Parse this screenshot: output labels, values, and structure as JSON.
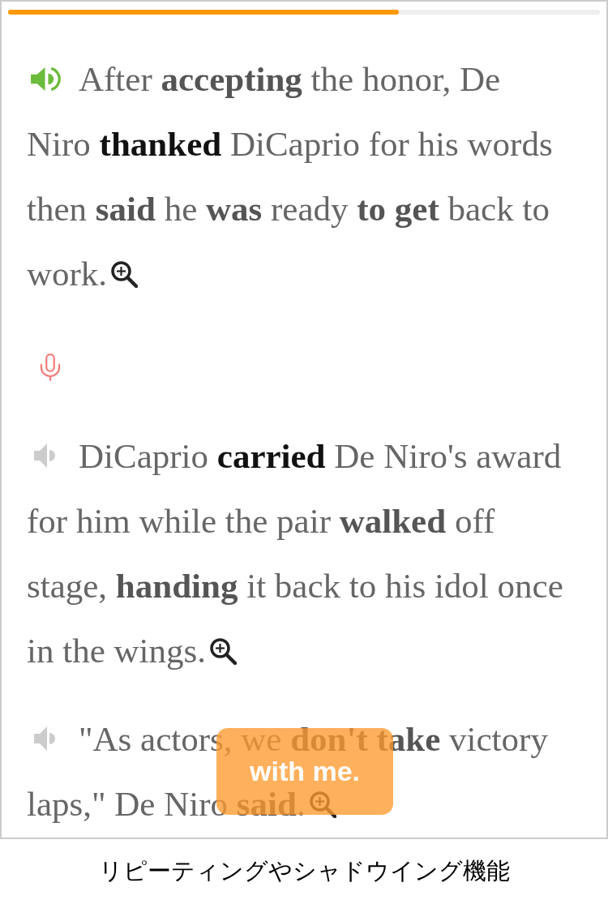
{
  "progress": {
    "level": 0.66
  },
  "items": [
    {
      "kind": "sentence",
      "playing": true,
      "lines": [
        [
          {
            "text": "After ",
            "kind": "plain",
            "selected": false
          },
          {
            "text": "accepting",
            "kind": "keyword",
            "selected": false
          },
          {
            "text": " the honor, De",
            "kind": "plain",
            "selected": false
          }
        ],
        [
          {
            "text": "Niro ",
            "kind": "plain",
            "selected": false
          },
          {
            "text": "thanked",
            "kind": "keyword",
            "selected": true
          },
          {
            "text": " DiCaprio for his words",
            "kind": "plain",
            "selected": false
          }
        ],
        [
          {
            "text": "then ",
            "kind": "plain",
            "selected": false
          },
          {
            "text": "said",
            "kind": "keyword",
            "selected": false
          },
          {
            "text": " he ",
            "kind": "plain",
            "selected": false
          },
          {
            "text": "was",
            "kind": "keyword",
            "selected": false
          },
          {
            "text": " ready ",
            "kind": "plain",
            "selected": false
          },
          {
            "text": "to get",
            "kind": "keyword",
            "selected": false
          },
          {
            "text": " back to",
            "kind": "plain",
            "selected": false
          }
        ],
        [
          {
            "text": "work.",
            "kind": "plain",
            "selected": false
          }
        ]
      ]
    },
    {
      "kind": "record"
    },
    {
      "kind": "sentence",
      "playing": false,
      "lines": [
        [
          {
            "text": "DiCaprio ",
            "kind": "plain",
            "selected": false
          },
          {
            "text": "carried",
            "kind": "keyword",
            "selected": true
          },
          {
            "text": " De Niro's award",
            "kind": "plain",
            "selected": false
          }
        ],
        [
          {
            "text": "for him while the pair ",
            "kind": "plain",
            "selected": false
          },
          {
            "text": "walked",
            "kind": "keyword",
            "selected": false
          },
          {
            "text": " off",
            "kind": "plain",
            "selected": false
          }
        ],
        [
          {
            "text": "stage, ",
            "kind": "plain",
            "selected": false
          },
          {
            "text": "handing",
            "kind": "keyword",
            "selected": false
          },
          {
            "text": " it back to his idol once",
            "kind": "plain",
            "selected": false
          }
        ],
        [
          {
            "text": "in the wings.",
            "kind": "plain",
            "selected": false
          }
        ]
      ]
    },
    {
      "kind": "sentence",
      "playing": false,
      "lines": [
        [
          {
            "text": "\"As actors, we ",
            "kind": "plain",
            "selected": false
          },
          {
            "text": "don't take",
            "kind": "keyword",
            "selected": false
          },
          {
            "text": " victory",
            "kind": "plain",
            "selected": false
          }
        ],
        [
          {
            "text": "laps,\" De Niro ",
            "kind": "plain",
            "selected": false
          },
          {
            "text": "said",
            "kind": "keyword",
            "selected": false
          },
          {
            "text": ".",
            "kind": "plain",
            "selected": false
          }
        ]
      ]
    }
  ],
  "toast": {
    "text": "with me."
  },
  "caption": "リピーティングやシャドウイング機能"
}
